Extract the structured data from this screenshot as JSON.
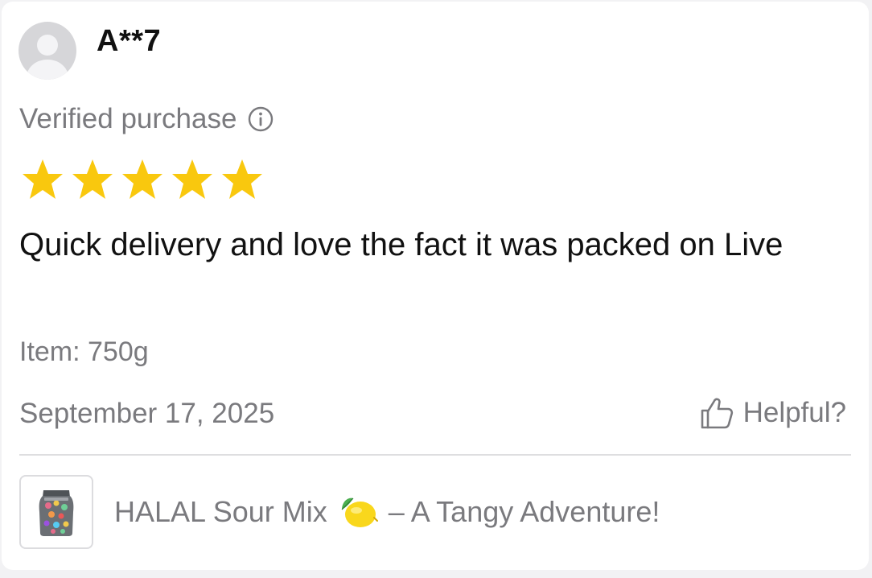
{
  "review": {
    "username": "A**7",
    "verified_label": "Verified purchase",
    "rating": 5,
    "rating_max": 5,
    "text": "Quick delivery and love the fact it was packed on Live",
    "item": "Item: 750g",
    "date": "September 17, 2025",
    "helpful_label": "Helpful?"
  },
  "product": {
    "title_before": "HALAL Sour Mix",
    "title_after": "– A Tangy Adventure!"
  },
  "icons": {
    "avatar": "default-avatar-icon",
    "info": "info-icon",
    "star": "star-icon",
    "helpful": "thumbs-up-icon",
    "lemon": "lemon-emoji-icon"
  },
  "colors": {
    "star": "#F9C80E",
    "text_primary": "#111111",
    "text_secondary": "#7A7A7E"
  }
}
